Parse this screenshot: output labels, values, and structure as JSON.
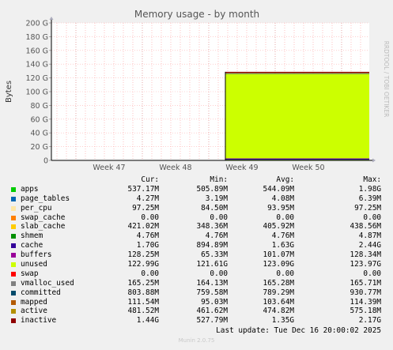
{
  "chart_data": {
    "type": "area",
    "title": "Memory usage - by month",
    "ylabel": "Bytes",
    "watermark": "RRDTOOL / TOBI OETIKER",
    "ylim": [
      0,
      200
    ],
    "yunit": "G",
    "yticks": [
      "0",
      "20 G",
      "40 G",
      "60 G",
      "80 G",
      "100 G",
      "120 G",
      "140 G",
      "160 G",
      "180 G",
      "200 G"
    ],
    "xticks": [
      "Week 47",
      "Week 48",
      "Week 49",
      "Week 50"
    ],
    "columns": [
      "Cur:",
      "Min:",
      "Avg:",
      "Max:"
    ],
    "area_start_label": "Week 49",
    "series": [
      {
        "name": "apps",
        "color": "#00cc00",
        "cur": "537.17M",
        "min": "505.89M",
        "avg": "544.09M",
        "max": "1.98G"
      },
      {
        "name": "page_tables",
        "color": "#0066b3",
        "cur": "4.27M",
        "min": "3.19M",
        "avg": "4.08M",
        "max": "6.39M"
      },
      {
        "name": "per_cpu",
        "color": "#ffe6a5",
        "cur": "97.25M",
        "min": "84.50M",
        "avg": "93.95M",
        "max": "97.25M"
      },
      {
        "name": "swap_cache",
        "color": "#ff8000",
        "cur": "0.00",
        "min": "0.00",
        "avg": "0.00",
        "max": "0.00"
      },
      {
        "name": "slab_cache",
        "color": "#ffcc00",
        "cur": "421.02M",
        "min": "348.36M",
        "avg": "405.92M",
        "max": "438.56M"
      },
      {
        "name": "shmem",
        "color": "#008f00",
        "cur": "4.76M",
        "min": "4.76M",
        "avg": "4.76M",
        "max": "4.87M"
      },
      {
        "name": "cache",
        "color": "#330099",
        "cur": "1.70G",
        "min": "894.89M",
        "avg": "1.63G",
        "max": "2.44G"
      },
      {
        "name": "buffers",
        "color": "#990099",
        "cur": "128.25M",
        "min": "65.33M",
        "avg": "101.07M",
        "max": "128.34M"
      },
      {
        "name": "unused",
        "color": "#ccff00",
        "cur": "122.99G",
        "min": "121.61G",
        "avg": "123.09G",
        "max": "123.97G"
      },
      {
        "name": "swap",
        "color": "#ff0000",
        "cur": "0.00",
        "min": "0.00",
        "avg": "0.00",
        "max": "0.00"
      },
      {
        "name": "vmalloc_used",
        "color": "#808080",
        "cur": "165.25M",
        "min": "164.13M",
        "avg": "165.28M",
        "max": "165.71M"
      },
      {
        "name": "committed",
        "color": "#004b6b",
        "cur": "803.88M",
        "min": "759.58M",
        "avg": "789.29M",
        "max": "930.77M"
      },
      {
        "name": "mapped",
        "color": "#b35a00",
        "cur": "111.54M",
        "min": "95.03M",
        "avg": "103.64M",
        "max": "114.39M"
      },
      {
        "name": "active",
        "color": "#b38f00",
        "cur": "481.52M",
        "min": "461.62M",
        "avg": "474.82M",
        "max": "575.18M"
      },
      {
        "name": "inactive",
        "color": "#8f0000",
        "cur": "1.44G",
        "min": "527.79M",
        "avg": "1.35G",
        "max": "2.17G"
      }
    ]
  },
  "footer": {
    "last_update": "Last update: Tue Dec 16 20:00:02 2025",
    "munin": "Munin 2.0.75"
  }
}
